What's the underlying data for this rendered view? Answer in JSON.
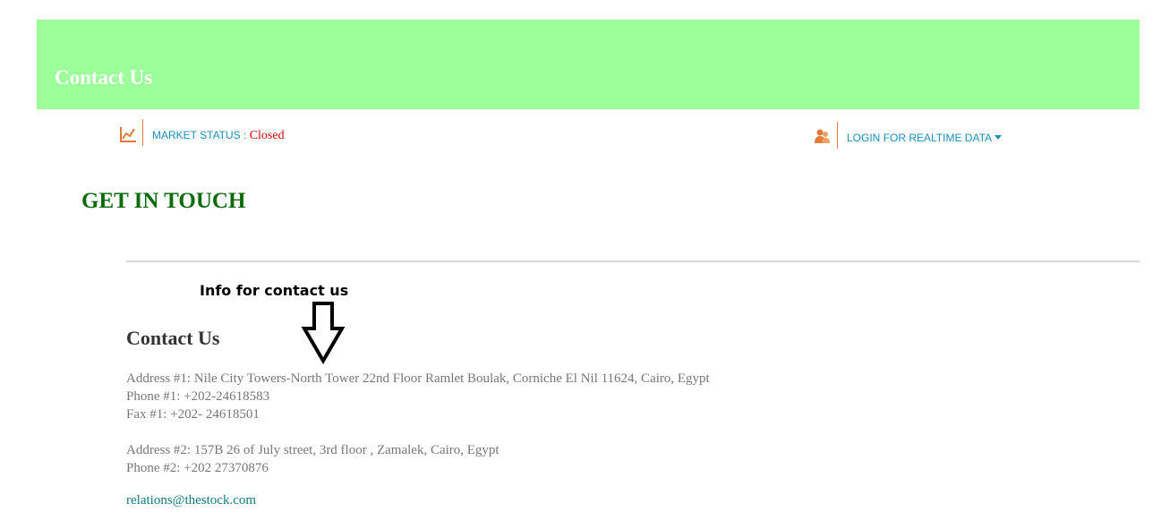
{
  "header": {
    "title": "Contact Us",
    "background_color": "#9cff9a"
  },
  "status_bar": {
    "market_icon": "line-chart-icon",
    "market_label": "MARKET STATUS :",
    "market_value": "Closed",
    "login_icon": "users-icon",
    "login_label": "LOGIN FOR REALTIME DATA",
    "accent_color": "#e07b39",
    "link_color": "#1a8fb8"
  },
  "main": {
    "section_title": "GET IN TOUCH",
    "annotation": "Info for contact us",
    "annotation_icon": "down-arrow-icon",
    "contact_heading": "Contact Us",
    "address1": "Address #1: Nile City Towers-North Tower 22nd Floor Ramlet Boulak, Corniche El Nil 11624, Cairo, Egypt",
    "phone1": "Phone #1: +202-24618583",
    "fax1": "Fax #1: +202- 24618501",
    "address2": "Address #2: 157B 26 of July street, 3rd floor , Zamalek, Cairo, Egypt",
    "phone2": "Phone #2: +202 27370876",
    "email": "relations@thestock.com"
  }
}
